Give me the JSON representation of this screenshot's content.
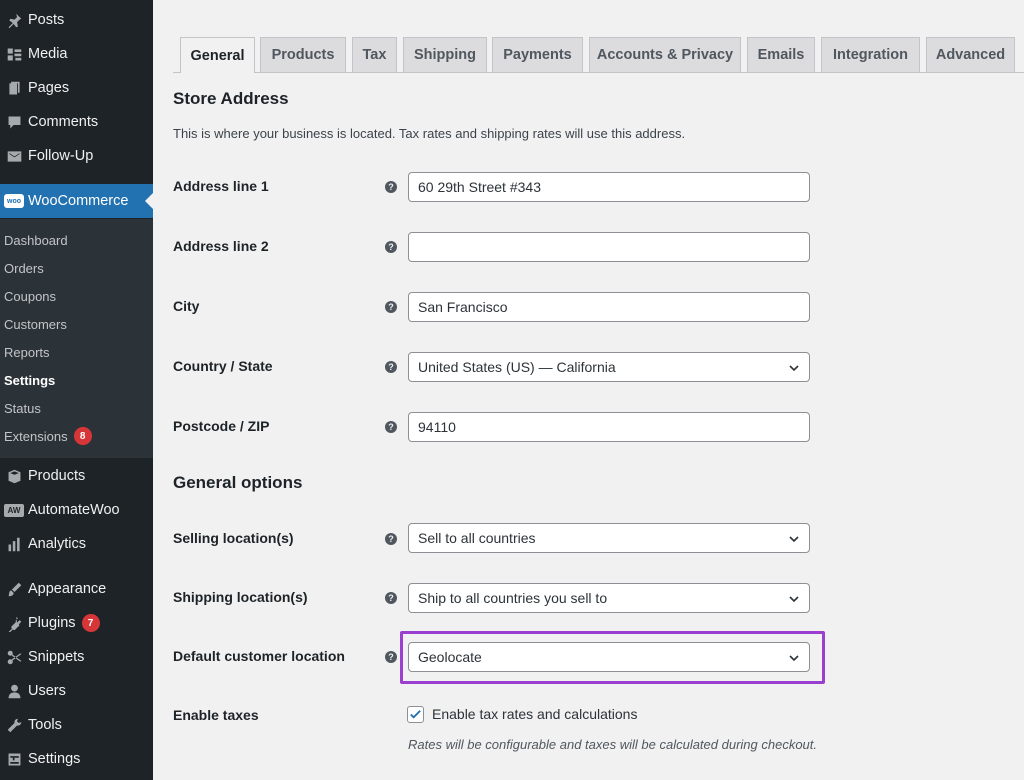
{
  "sidebar": {
    "items_top": [
      {
        "label": "Posts",
        "icon": "pin-icon"
      },
      {
        "label": "Media",
        "icon": "media-icon"
      },
      {
        "label": "Pages",
        "icon": "pages-icon"
      },
      {
        "label": "Comments",
        "icon": "comments-icon"
      },
      {
        "label": "Follow-Up",
        "icon": "mail-icon"
      }
    ],
    "woocommerce": {
      "label": "WooCommerce",
      "logo_text": "woo"
    },
    "submenu": [
      {
        "label": "Dashboard"
      },
      {
        "label": "Orders"
      },
      {
        "label": "Coupons"
      },
      {
        "label": "Customers"
      },
      {
        "label": "Reports"
      },
      {
        "label": "Settings"
      },
      {
        "label": "Status"
      },
      {
        "label": "Extensions",
        "badge": "8"
      }
    ],
    "items_bottom": [
      {
        "label": "Products",
        "icon": "box-icon"
      },
      {
        "label": "AutomateWoo",
        "icon": "aw-icon",
        "logo_text": "AW"
      },
      {
        "label": "Analytics",
        "icon": "bar-chart-icon"
      },
      {
        "label": "Appearance",
        "icon": "paintbrush-icon"
      },
      {
        "label": "Plugins",
        "icon": "plug-icon",
        "badge": "7"
      },
      {
        "label": "Snippets",
        "icon": "scissors-icon"
      },
      {
        "label": "Users",
        "icon": "user-icon"
      },
      {
        "label": "Tools",
        "icon": "wrench-icon"
      },
      {
        "label": "Settings",
        "icon": "settings-icon"
      }
    ]
  },
  "tabs": [
    {
      "label": "General",
      "active": true
    },
    {
      "label": "Products"
    },
    {
      "label": "Tax"
    },
    {
      "label": "Shipping"
    },
    {
      "label": "Payments"
    },
    {
      "label": "Accounts & Privacy"
    },
    {
      "label": "Emails"
    },
    {
      "label": "Integration"
    },
    {
      "label": "Advanced"
    }
  ],
  "store_address": {
    "heading": "Store Address",
    "description": "This is where your business is located. Tax rates and shipping rates will use this address.",
    "fields": [
      {
        "label": "Address line 1",
        "value": "60 29th Street #343"
      },
      {
        "label": "Address line 2",
        "value": ""
      },
      {
        "label": "City",
        "value": "San Francisco"
      },
      {
        "label": "Country / State",
        "value": "United States (US) — California"
      },
      {
        "label": "Postcode / ZIP",
        "value": "94110"
      }
    ]
  },
  "general_options": {
    "heading": "General options",
    "fields": [
      {
        "label": "Selling location(s)",
        "value": "Sell to all countries"
      },
      {
        "label": "Shipping location(s)",
        "value": "Ship to all countries you sell to"
      },
      {
        "label": "Default customer location",
        "value": "Geolocate"
      }
    ],
    "enable_taxes": {
      "label": "Enable taxes",
      "checkbox_label": "Enable tax rates and calculations",
      "checked": true,
      "note": "Rates will be configurable and taxes will be calculated during checkout."
    }
  },
  "help_glyph": "?",
  "colors": {
    "sidebar_bg": "#1d2327",
    "accent": "#2271b1",
    "highlight": "#9b3fd0",
    "badge": "#d63638"
  }
}
